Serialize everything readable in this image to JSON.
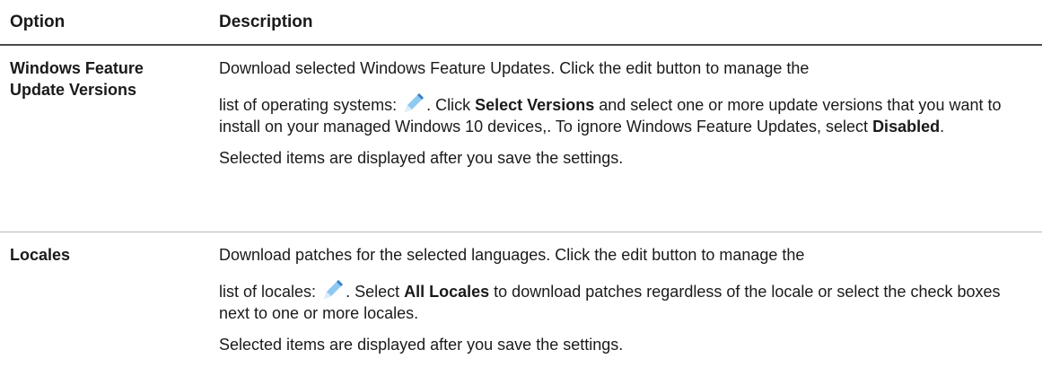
{
  "header": {
    "option": "Option",
    "description": "Description"
  },
  "rows": [
    {
      "option": "Windows Feature Update Versions",
      "p1_a": "Download selected Windows Feature Updates. Click the edit button to manage the",
      "p1_b": "list of operating systems:",
      "p1_c": ". Click",
      "p1_bold1": "Select Versions",
      "p1_d": "and select one or more update versions that you want to install on your managed Windows 10 devices,. To ignore Windows Feature Updates, select",
      "p1_bold2": "Disabled",
      "p1_e": ".",
      "p2": "Selected items are displayed after you save the settings."
    },
    {
      "option": "Locales",
      "p1_a": "Download patches for the selected languages. Click the edit button to manage the",
      "p1_b": "list of locales:",
      "p1_c": ". Select",
      "p1_bold1": "All Locales",
      "p1_d": "to download patches regardless of the locale or select the check boxes next to one or more locales.",
      "p2": "Selected items are displayed after you save the settings."
    }
  ],
  "icons": {
    "edit": "pencil-icon"
  },
  "colors": {
    "pencil_light": "#8ec9f2",
    "pencil_dark": "#3b7fc4"
  }
}
